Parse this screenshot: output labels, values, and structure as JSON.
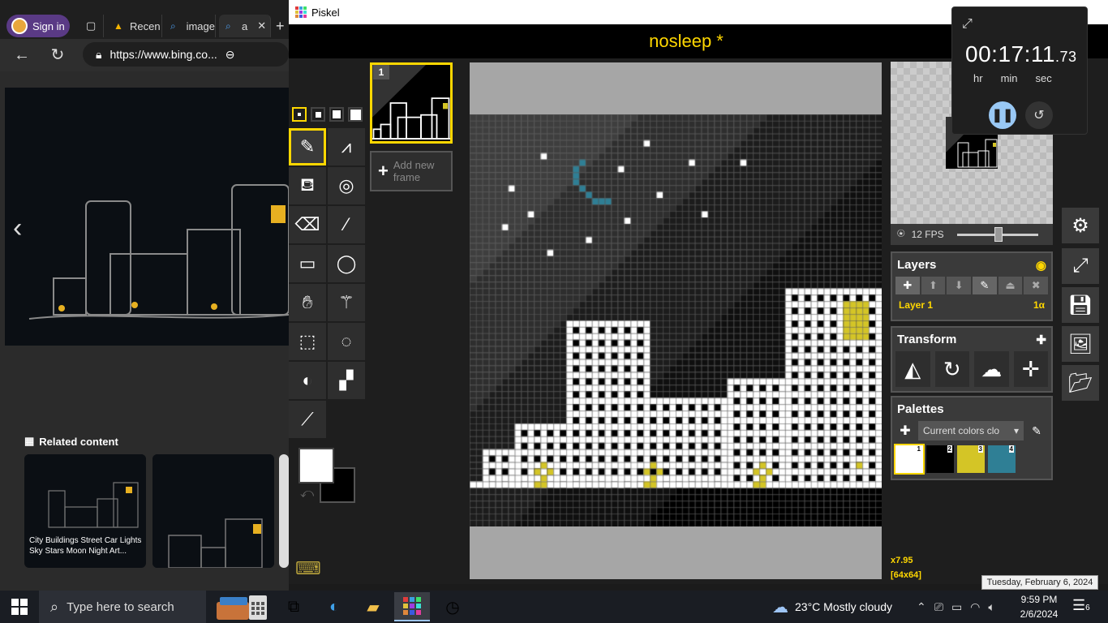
{
  "browser": {
    "sign_in": "Sign in",
    "tabs": [
      {
        "label": "Recen"
      },
      {
        "label": "image"
      },
      {
        "label": "a"
      }
    ],
    "url": "https://www.bing.co...",
    "related_title": "Related content",
    "related_caption": "City Buildings Street Car Lights Sky Stars Moon Night Art..."
  },
  "piskel": {
    "window_title": "Piskel",
    "document_title": "nosleep *",
    "frame_number": "1",
    "add_frame_label": "Add new frame",
    "fps_label": "12 FPS",
    "fps_value": 12,
    "layers": {
      "title": "Layers",
      "items": [
        {
          "name": "Layer 1",
          "alpha": "1α"
        }
      ]
    },
    "transform": {
      "title": "Transform"
    },
    "palettes": {
      "title": "Palettes",
      "selected": "Current colors clo",
      "swatches": [
        {
          "index": "1",
          "color": "#ffffff"
        },
        {
          "index": "2",
          "color": "#000000"
        },
        {
          "index": "3",
          "color": "#d4c526"
        },
        {
          "index": "4",
          "color": "#2f7f95"
        }
      ]
    },
    "zoom": "x7.95",
    "size": "[64x64]",
    "colors": {
      "primary": "#ffffff",
      "secondary": "#000000",
      "accent": "#ffd700"
    }
  },
  "clock": {
    "hours": "00",
    "minutes": "17",
    "seconds": "11",
    "hundredths": ".73",
    "sep1": ":",
    "sep2": ":",
    "unit_hr": "hr",
    "unit_min": "min",
    "unit_sec": "sec"
  },
  "tooltip": "Tuesday, February 6, 2024",
  "taskbar": {
    "search_placeholder": "Type here to search",
    "weather": "23°C  Mostly cloudy",
    "time": "9:59 PM",
    "date": "2/6/2024",
    "notification_count": "6"
  }
}
